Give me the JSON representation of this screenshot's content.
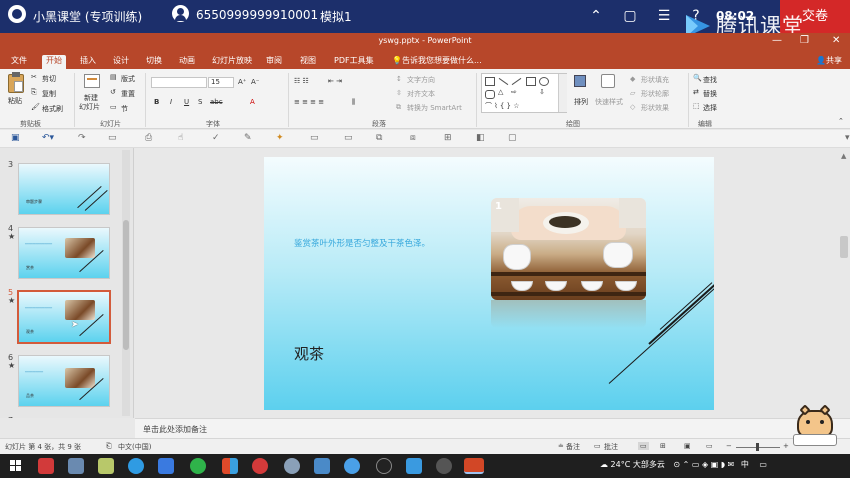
{
  "exam": {
    "app_title": "小黑课堂 (专项训练)",
    "account": "6550999999910001",
    "mode": "模拟1",
    "time": "08:02",
    "submit": "交卷"
  },
  "ppt": {
    "file_title": "yswg.pptx - PowerPoint",
    "share": "共享",
    "tabs": [
      "文件",
      "开始",
      "插入",
      "设计",
      "切换",
      "动画",
      "幻灯片放映",
      "审阅",
      "视图",
      "PDF工具集"
    ],
    "active_tab": "开始",
    "tell_me": "告诉我您想要做什么..."
  },
  "ribbon": {
    "clipboard": {
      "paste": "粘贴",
      "cut": "剪切",
      "copy": "复制",
      "format_painter": "格式刷",
      "label": "剪贴板"
    },
    "slides": {
      "new_slide": "新建",
      "new_slide_2": "幻灯片",
      "layout": "版式",
      "reset": "重置",
      "section": "节",
      "label": "幻灯片"
    },
    "font": {
      "size": "15",
      "label": "字体",
      "bold": "B",
      "italic": "I",
      "underline": "U",
      "strike": "S",
      "shadow": "abc"
    },
    "paragraph": {
      "text_direction": "文字方向",
      "align_text": "对齐文本",
      "smartart": "转换为 SmartArt",
      "label": "段落"
    },
    "drawing": {
      "arrange": "排列",
      "quick_styles": "快速样式",
      "fill": "形状填充",
      "outline": "形状轮廓",
      "effects": "形状效果",
      "label": "绘图"
    },
    "editing": {
      "find": "查找",
      "replace": "替换",
      "select": "选择",
      "label": "编辑"
    }
  },
  "thumbnails": [
    {
      "num": "3",
      "caption": "审题步骤"
    },
    {
      "num": "4",
      "caption": "赏茶"
    },
    {
      "num": "5",
      "caption": "观茶"
    },
    {
      "num": "6",
      "caption": "品茶"
    },
    {
      "num": "7",
      "caption": ""
    }
  ],
  "slide": {
    "subtitle": "鉴赏茶叶外形是否匀整及干茶色泽。",
    "title": "观茶",
    "image_number": "1"
  },
  "notes": {
    "placeholder": "单击此处添加备注"
  },
  "status": {
    "slide_info": "幻灯片 第 4 张，共 9 张",
    "language": "中文(中国)",
    "notes": "备注",
    "comments": "批注"
  },
  "taskbar": {
    "weather": "24°C 大部多云",
    "ime": "中"
  },
  "watermark": {
    "text": "腾讯课堂"
  }
}
